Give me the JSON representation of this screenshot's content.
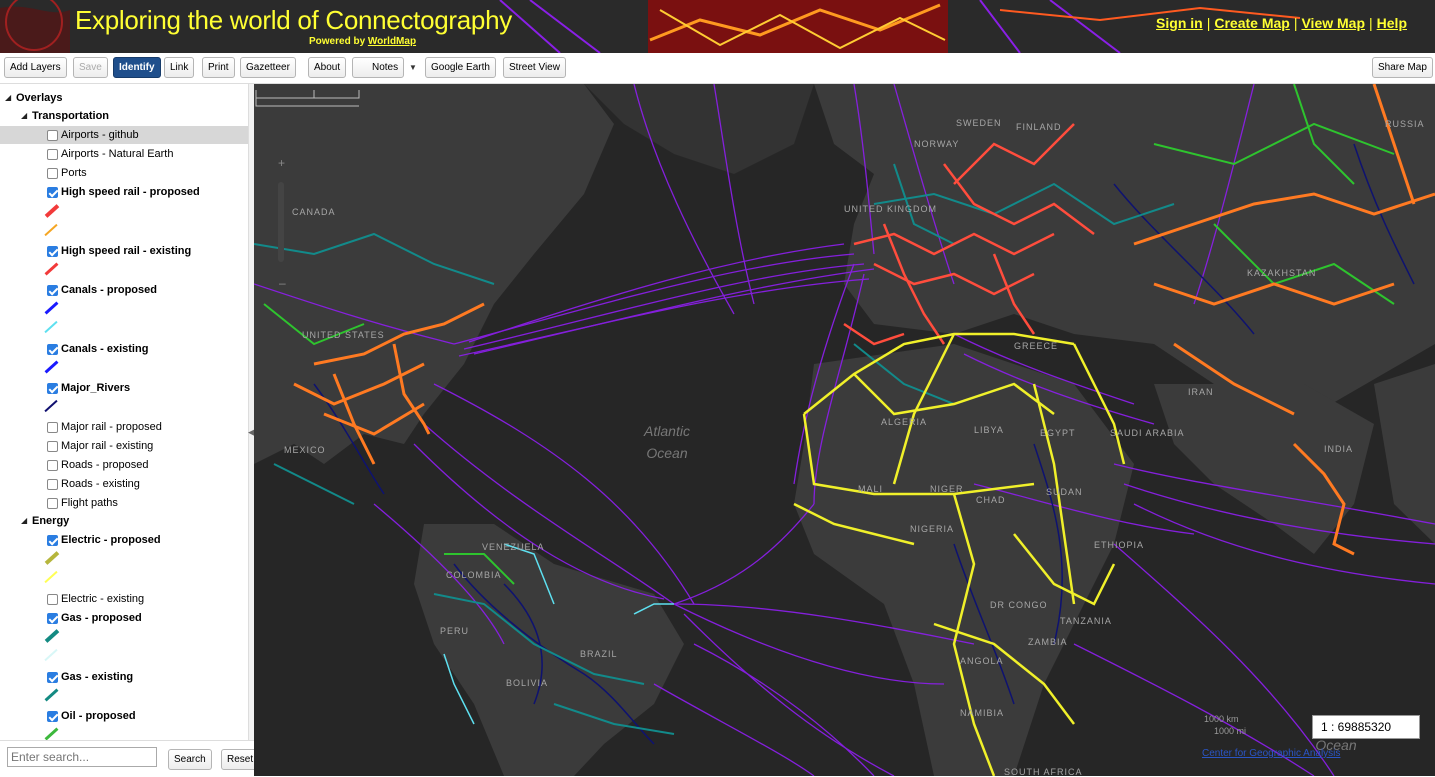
{
  "header": {
    "title": "Exploring the world of Connectography",
    "powered_prefix": "Powered by ",
    "powered_link": "WorldMap",
    "links": [
      "Sign in",
      "Create Map",
      "View Map",
      "Help"
    ],
    "separator": "|"
  },
  "toolbar": {
    "add_layers": "Add Layers",
    "save": "Save",
    "identify": "Identify",
    "link": "Link",
    "print": "Print",
    "gazetteer": "Gazetteer",
    "about": "About",
    "notes": "Notes",
    "google_earth": "Google Earth",
    "street_view": "Street View",
    "share_map": "Share Map"
  },
  "layers": {
    "overlays": "Overlays",
    "transportation": "Transportation",
    "energy": "Energy",
    "items": [
      {
        "label": "Airports - github",
        "checked": false
      },
      {
        "label": "Airports - Natural Earth",
        "checked": false
      },
      {
        "label": "Ports",
        "checked": false
      },
      {
        "label": "High speed rail - proposed",
        "checked": true,
        "swatches": [
          "#f23a3a",
          "#f5a623"
        ]
      },
      {
        "label": "High speed rail - existing",
        "checked": true,
        "swatches": [
          "#f23a3a"
        ]
      },
      {
        "label": "Canals - proposed",
        "checked": true,
        "swatches": [
          "#1a1aff",
          "#5ee0f0"
        ]
      },
      {
        "label": "Canals - existing",
        "checked": true,
        "swatches": [
          "#1a1aff"
        ]
      },
      {
        "label": "Major_Rivers",
        "checked": true,
        "swatches": [
          "#101070"
        ]
      },
      {
        "label": "Major rail - proposed",
        "checked": false
      },
      {
        "label": "Major rail - existing",
        "checked": false
      },
      {
        "label": "Roads - proposed",
        "checked": false
      },
      {
        "label": "Roads - existing",
        "checked": false
      },
      {
        "label": "Flight paths",
        "checked": false
      },
      {
        "label": "Electric - proposed",
        "checked": true,
        "swatches": [
          "#b6b63c",
          "#ffff55"
        ]
      },
      {
        "label": "Electric - existing",
        "checked": false
      },
      {
        "label": "Gas - proposed",
        "checked": true,
        "swatches": [
          "#138a82",
          "#d8f7f7"
        ]
      },
      {
        "label": "Gas - existing",
        "checked": true,
        "swatches": [
          "#138a82"
        ]
      },
      {
        "label": "Oil - proposed",
        "checked": true,
        "swatches": [
          "#3cb83c"
        ]
      }
    ]
  },
  "search": {
    "placeholder": "Enter search...",
    "search_label": "Search",
    "reset_label": "Reset"
  },
  "map": {
    "ocean": [
      "Atlantic",
      "Ocean"
    ],
    "ocean2": "Ocean",
    "labels": [
      "CANADA",
      "UNITED STATES",
      "MEXICO",
      "VENEZUELA",
      "COLOMBIA",
      "PERU",
      "BRAZIL",
      "BOLIVIA",
      "NORWAY",
      "SWEDEN",
      "FINLAND",
      "UNITED KINGDOM",
      "RUSSIA",
      "KAZAKHSTAN",
      "GREECE",
      "IRAN",
      "ALGERIA",
      "LIBYA",
      "EGYPT",
      "SAUDI ARABIA",
      "INDIA",
      "MALI",
      "NIGER",
      "CHAD",
      "SUDAN",
      "NIGERIA",
      "ETHIOPIA",
      "DR CONGO",
      "TANZANIA",
      "ANGOLA",
      "ZAMBIA",
      "NAMIBIA",
      "SOUTH AFRICA"
    ],
    "scale_km": "1000 km",
    "scale_mi": "1000 mi",
    "scale_ratio": "1 : 69885320",
    "attribution": "Center for Geographic Analysis",
    "colors": {
      "ocean": "#262626",
      "land": "#3b3b3b",
      "flight": "#8a1fe6",
      "rail_hs": "#ff4d3d",
      "rail_major": "#ff7a22",
      "electric": "#f0f02a",
      "gas": "#128a8a",
      "oil": "#2ec42e",
      "rivers": "#0e1270"
    }
  }
}
